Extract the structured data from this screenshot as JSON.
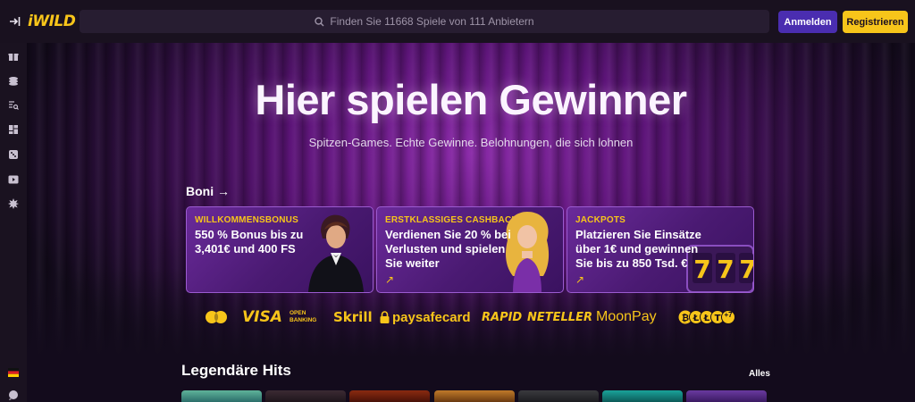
{
  "header": {
    "logo_text": "iWILD",
    "search_placeholder": "Finden Sie 11668 Spiele von 111 Anbietern",
    "login_label": "Anmelden",
    "register_label": "Registrieren"
  },
  "sidebar": {
    "icons": [
      "gift-icon",
      "coins-icon",
      "search-list-icon",
      "grid-icon",
      "dice-icon",
      "play-icon",
      "burst-icon",
      "flag-de-icon",
      "chat-icon"
    ]
  },
  "hero": {
    "title": "Hier spielen Gewinner",
    "subtitle": "Spitzen-Games. Echte Gewinne. Belohnungen, die sich lohnen"
  },
  "bonuses": {
    "heading": "Boni →",
    "cards": [
      {
        "tag": "WILLKOMMENSBONUS",
        "line1": "550 % Bonus bis zu",
        "line2": "3,401€ und 400 FS",
        "line3": ""
      },
      {
        "tag": "ERSTKLASSIGES CASHBACK",
        "line1": "Verdienen Sie 20 % bei",
        "line2": "Verlusten und spielen",
        "line3": "Sie weiter"
      },
      {
        "tag": "JACKPOTS",
        "line1": "Platzieren Sie Einsätze",
        "line2": "über 1€ und gewinnen",
        "line3": "Sie bis zu 850 Tsd. €"
      }
    ],
    "arrow": "↗"
  },
  "payments": {
    "visa": "VISA",
    "open_banking_1": "OPEN",
    "open_banking_2": "BANKING",
    "skrill": "Skrill",
    "paysafe": "paysafecard",
    "rapid": "RAPID",
    "neteller": "NETELLER",
    "moonpay": "MoonPay",
    "crypto_more": "+7"
  },
  "section": {
    "title": "Legendäre Hits",
    "see_all": "Alles"
  },
  "colors": {
    "accent_yellow": "#f7c51a",
    "login_purple": "#4a2db0",
    "background": "#130b1c"
  }
}
